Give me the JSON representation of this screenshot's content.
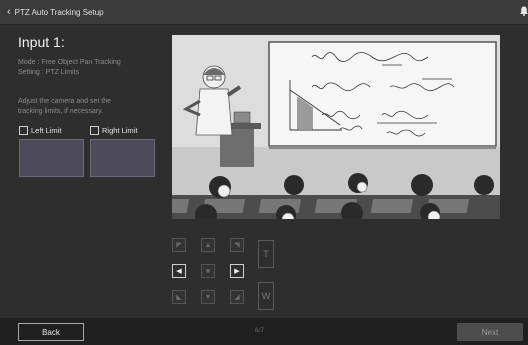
{
  "titlebar": {
    "title": "PTZ Auto Tracking Setup",
    "back_icon": "chevron-left-icon",
    "bell_icon": "bell-icon"
  },
  "input": {
    "heading": "Input 1:",
    "mode_info": "Mode : Free Object Pan Tracking\nSetting : PTZ Limits",
    "instructions": "Adjust the camera and set the\ntracking limits, if necessary.",
    "left_limit_label": "Left Limit",
    "right_limit_label": "Right Limit",
    "left_limit_checked": false,
    "right_limit_checked": false
  },
  "ptz_controls": {
    "zoom_tele": "T",
    "zoom_wide": "W"
  },
  "footer": {
    "back_label": "Back",
    "page": "6/7",
    "next_label": "Next"
  },
  "colors": {
    "background": "#2e2e2e",
    "thumbnail": "#4d4a5a",
    "next_disabled": "#4d4d4d"
  }
}
